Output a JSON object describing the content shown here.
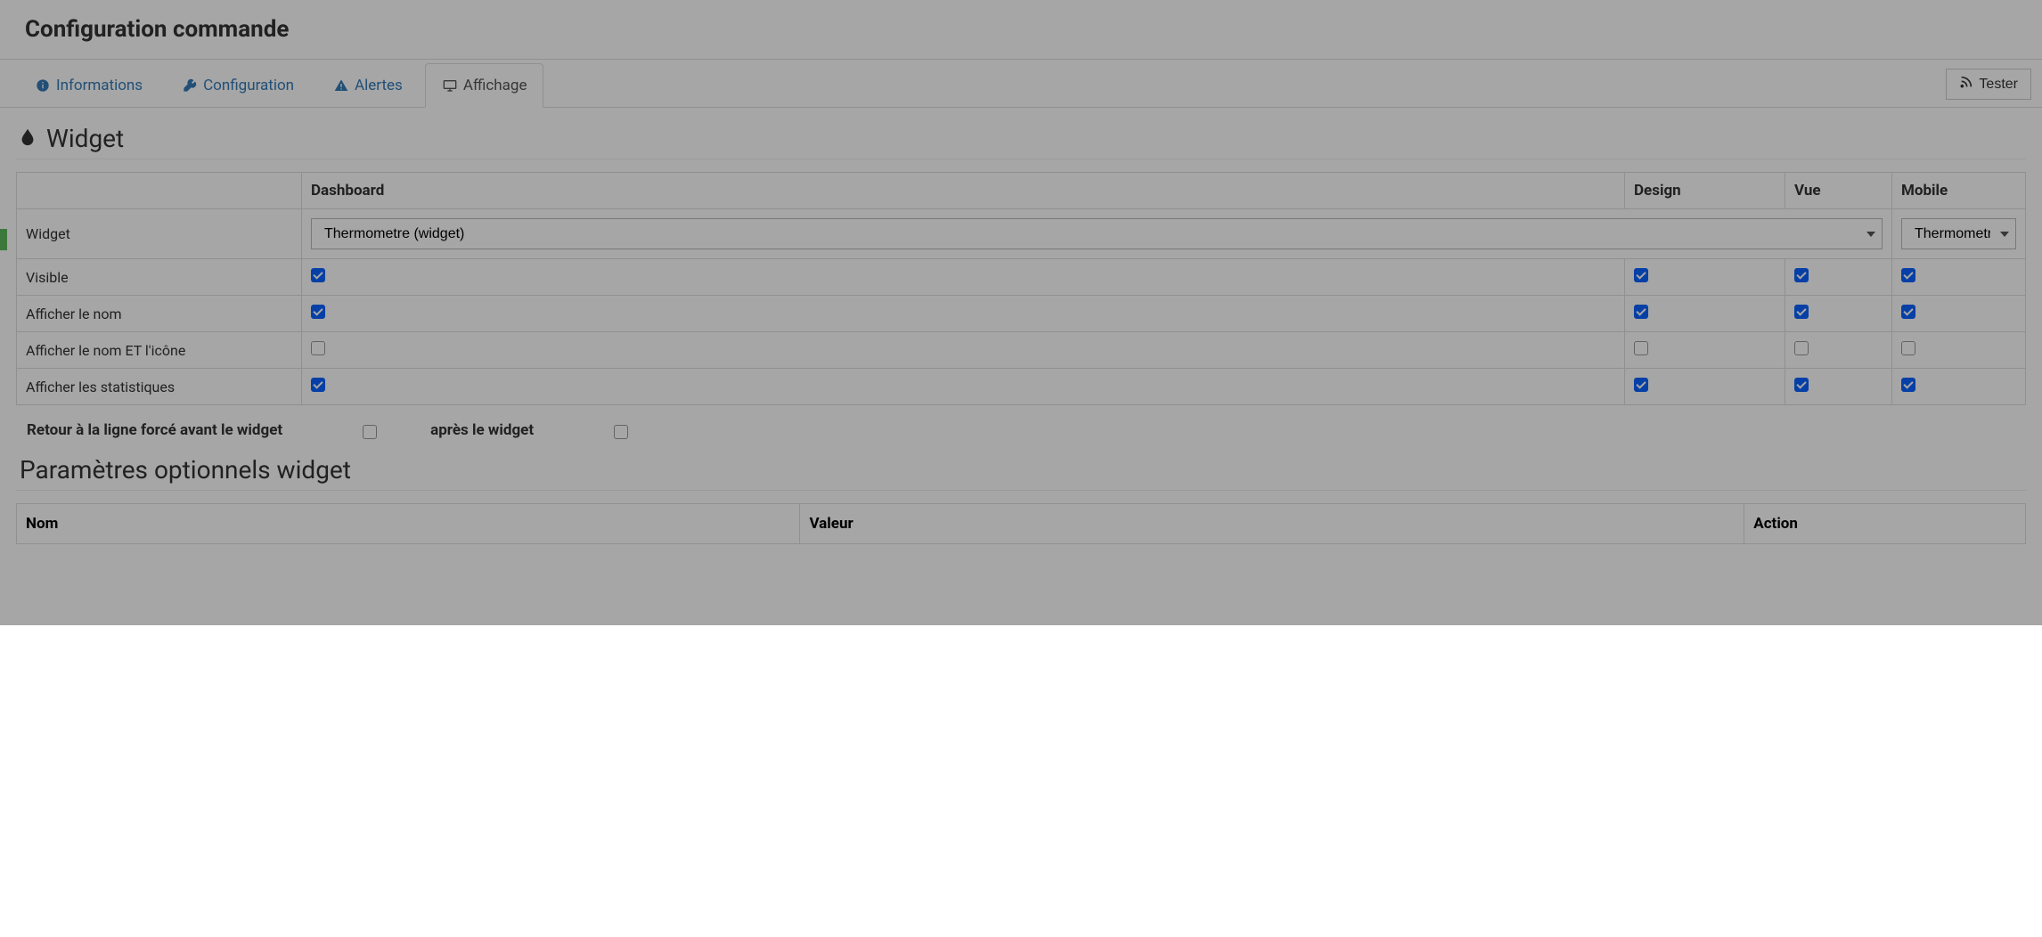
{
  "header": {
    "title": "Configuration commande"
  },
  "tabs": [
    {
      "label": "Informations",
      "icon": "info-icon"
    },
    {
      "label": "Configuration",
      "icon": "wrench-icon"
    },
    {
      "label": "Alertes",
      "icon": "warning-icon"
    },
    {
      "label": "Affichage",
      "icon": "monitor-icon"
    }
  ],
  "tester_label": "Tester",
  "widget": {
    "section_title": "Widget",
    "columns": {
      "blank": "",
      "dashboard": "Dashboard",
      "design": "Design",
      "vue": "Vue",
      "mobile": "Mobile"
    },
    "rows": [
      {
        "label": "Widget",
        "type": "select",
        "dashboard_value": "Thermometre (widget)",
        "mobile_value": "ThermometreMini (widget)"
      },
      {
        "label": "Visible",
        "type": "checkbox",
        "dashboard": true,
        "design": true,
        "vue": true,
        "mobile": true
      },
      {
        "label": "Afficher le nom",
        "type": "checkbox",
        "dashboard": true,
        "design": true,
        "vue": true,
        "mobile": true
      },
      {
        "label": "Afficher le nom ET l'icône",
        "type": "checkbox",
        "dashboard": false,
        "design": false,
        "vue": false,
        "mobile": false
      },
      {
        "label": "Afficher les statistiques",
        "type": "checkbox",
        "dashboard": true,
        "design": true,
        "vue": true,
        "mobile": true
      }
    ],
    "force_before": "Retour à la ligne forcé avant le widget",
    "force_before_checked": false,
    "force_after": "après le widget",
    "force_after_checked": false
  },
  "params": {
    "title": "Paramètres optionnels widget",
    "col_nom": "Nom",
    "col_valeur": "Valeur",
    "col_action": "Action"
  }
}
